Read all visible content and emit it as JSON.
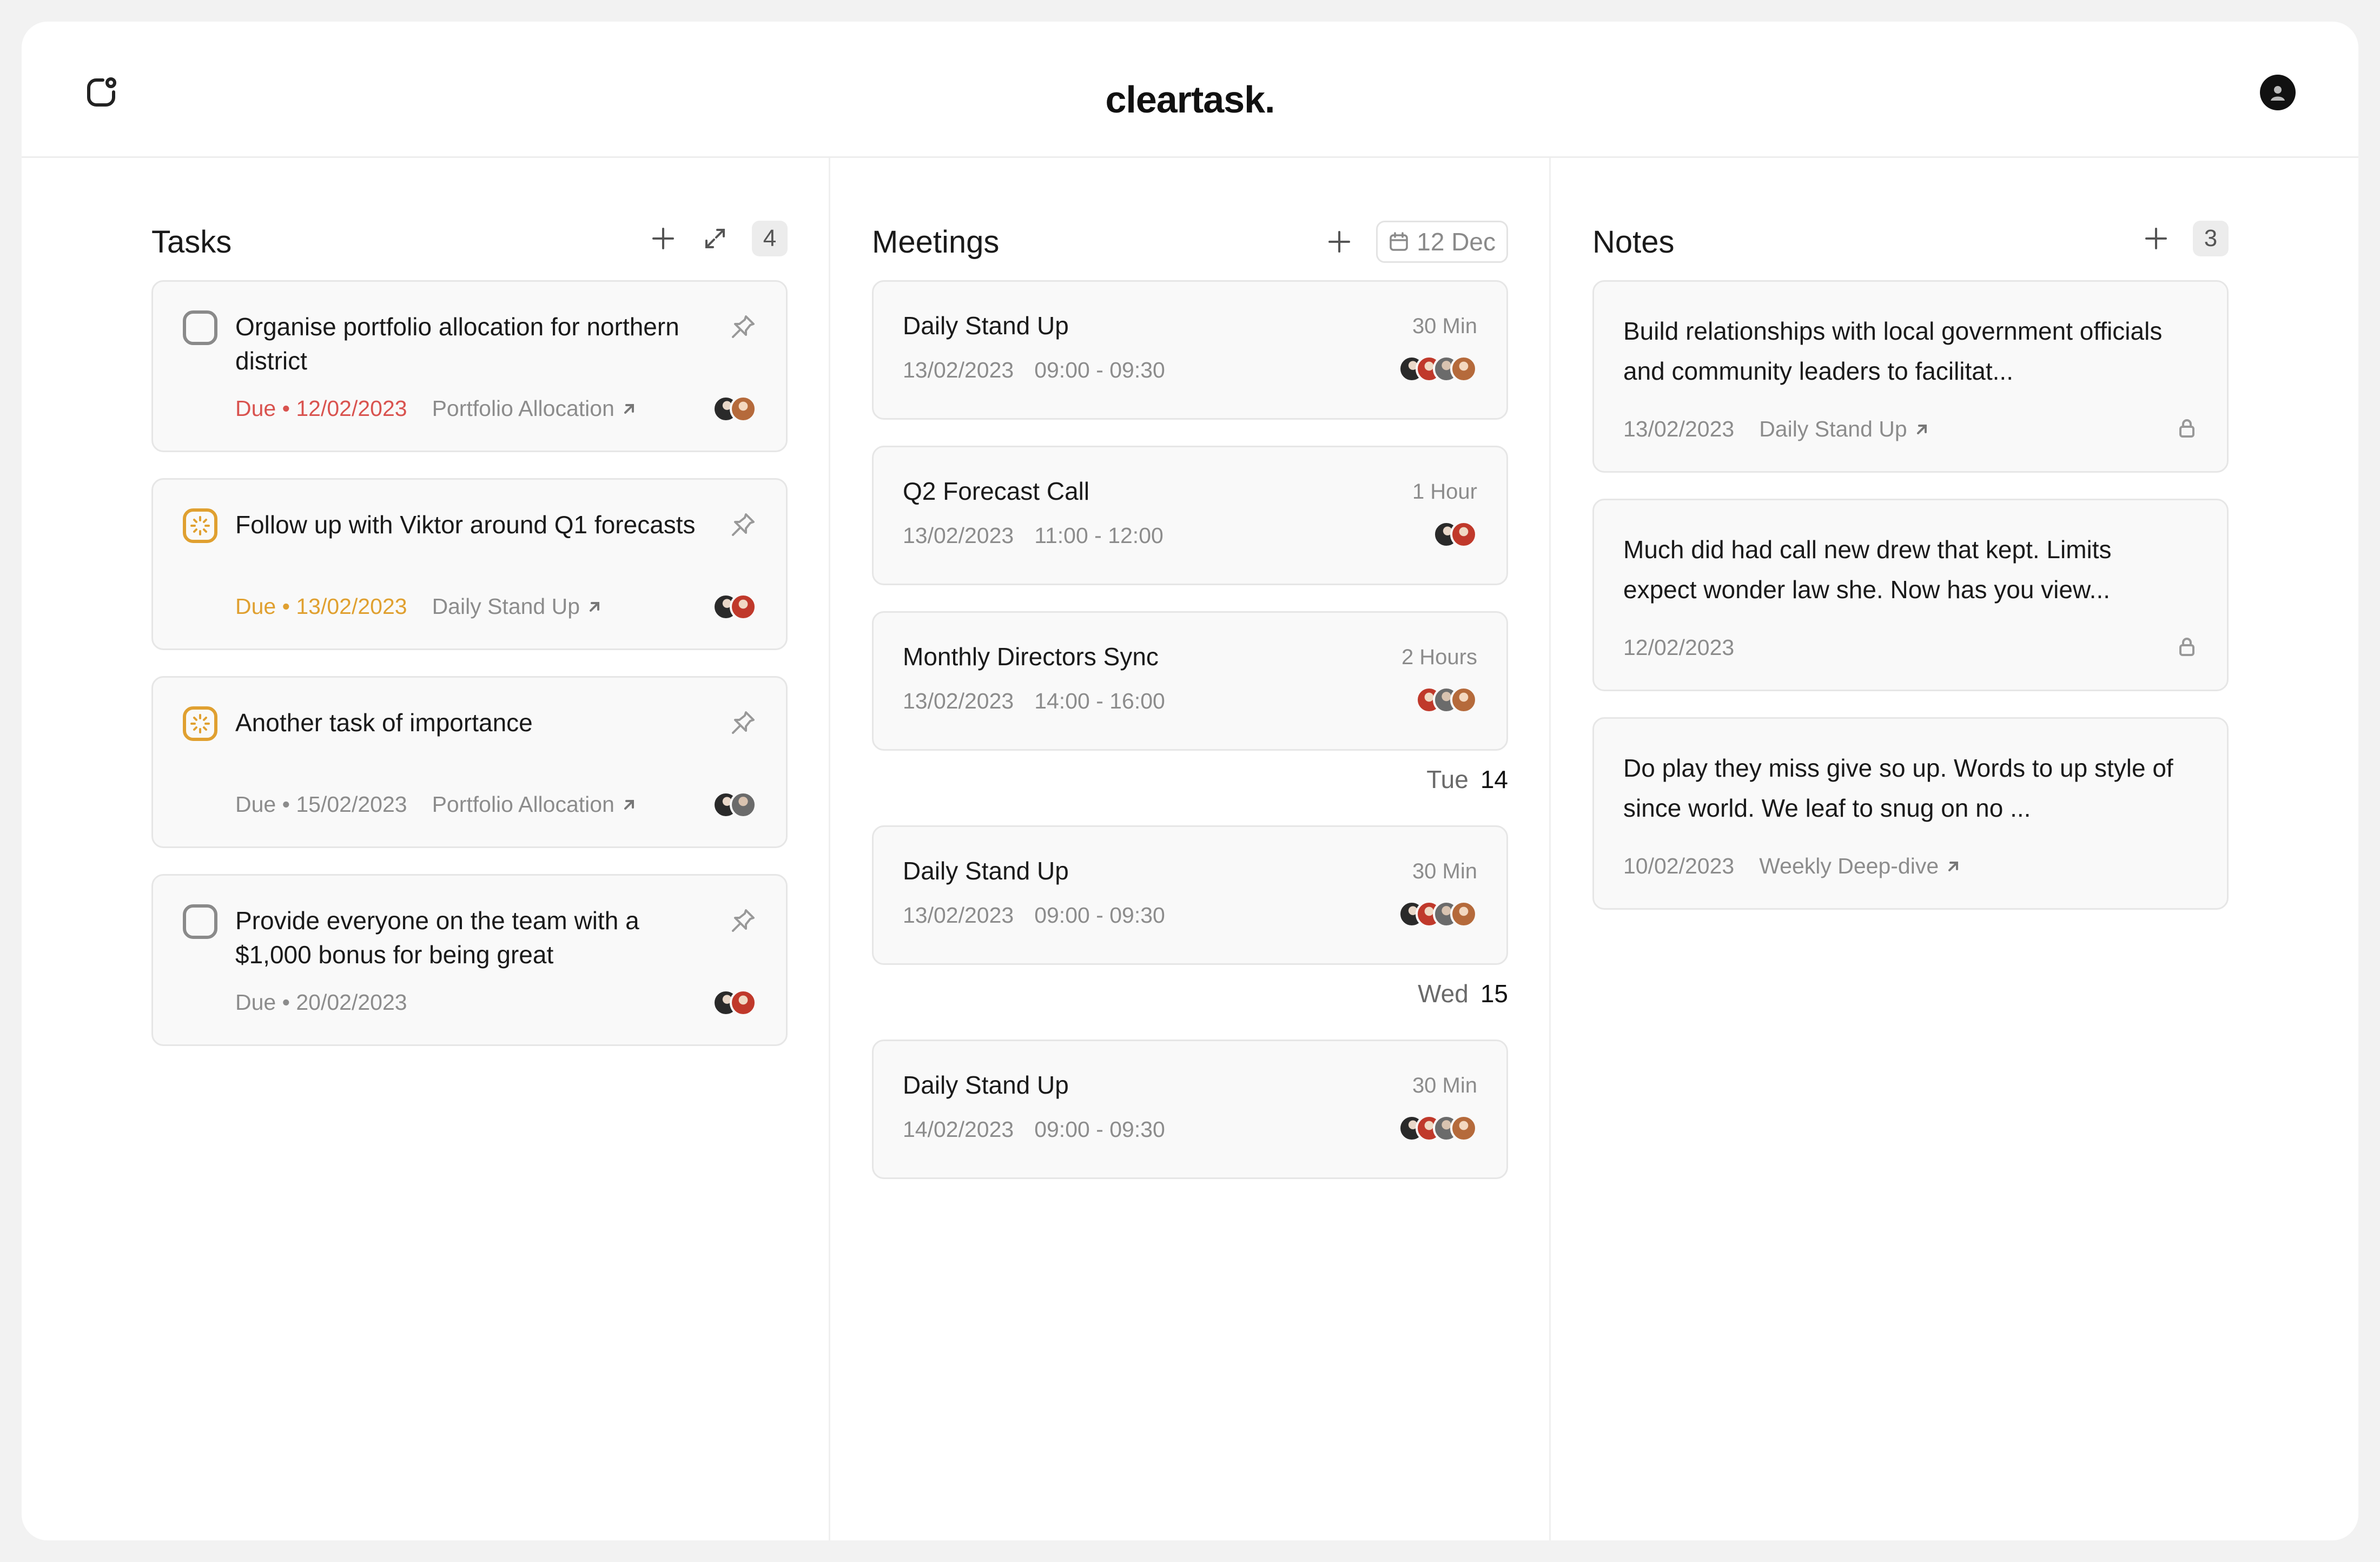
{
  "app": {
    "brand": "cleartask."
  },
  "colors": {
    "accent_orange": "#e0a030",
    "danger_red": "#d9534f",
    "muted": "#8c8c8c"
  },
  "tasks": {
    "title": "Tasks",
    "count": "4",
    "items": [
      {
        "title": "Organise portfolio allocation for northern district",
        "due": "Due • 12/02/2023",
        "due_status": "overdue",
        "link": "Portfolio Allocation",
        "status": "unchecked"
      },
      {
        "title": "Follow up with Viktor around Q1 forecasts",
        "due": "Due • 13/02/2023",
        "due_status": "soon",
        "link": "Daily Stand Up",
        "status": "in-progress"
      },
      {
        "title": "Another task of importance",
        "due": "Due • 15/02/2023",
        "due_status": "normal",
        "link": "Portfolio Allocation",
        "status": "in-progress"
      },
      {
        "title": "Provide everyone on the team with a $1,000 bonus for being great",
        "due": "Due • 20/02/2023",
        "due_status": "normal",
        "link": "",
        "status": "unchecked"
      }
    ]
  },
  "meetings": {
    "title": "Meetings",
    "date_chip": "12 Dec",
    "groups": [
      {
        "day": "",
        "date": "",
        "items": [
          {
            "title": "Daily Stand Up",
            "duration": "30 Min",
            "date": "13/02/2023",
            "time": "09:00 - 09:30"
          },
          {
            "title": "Q2 Forecast Call",
            "duration": "1 Hour",
            "date": "13/02/2023",
            "time": "11:00 - 12:00"
          },
          {
            "title": "Monthly Directors Sync",
            "duration": "2 Hours",
            "date": "13/02/2023",
            "time": "14:00 - 16:00"
          }
        ]
      },
      {
        "day": "Tue",
        "date": "14",
        "items": [
          {
            "title": "Daily Stand Up",
            "duration": "30 Min",
            "date": "13/02/2023",
            "time": "09:00 - 09:30"
          }
        ]
      },
      {
        "day": "Wed",
        "date": "15",
        "items": [
          {
            "title": "Daily Stand Up",
            "duration": "30 Min",
            "date": "14/02/2023",
            "time": "09:00 - 09:30"
          }
        ]
      }
    ]
  },
  "notes": {
    "title": "Notes",
    "count": "3",
    "items": [
      {
        "body": "Build relationships with local government officials and community leaders to facilitat...",
        "date": "13/02/2023",
        "link": "Daily Stand Up",
        "locked": true
      },
      {
        "body": "Much did had call new drew that kept. Limits expect wonder law she. Now has you view...",
        "date": "12/02/2023",
        "link": "",
        "locked": true
      },
      {
        "body": "Do play they miss give so up. Words to up style of since world. We leaf to snug on no ...",
        "date": "10/02/2023",
        "link": "Weekly Deep-dive",
        "locked": false
      }
    ]
  }
}
